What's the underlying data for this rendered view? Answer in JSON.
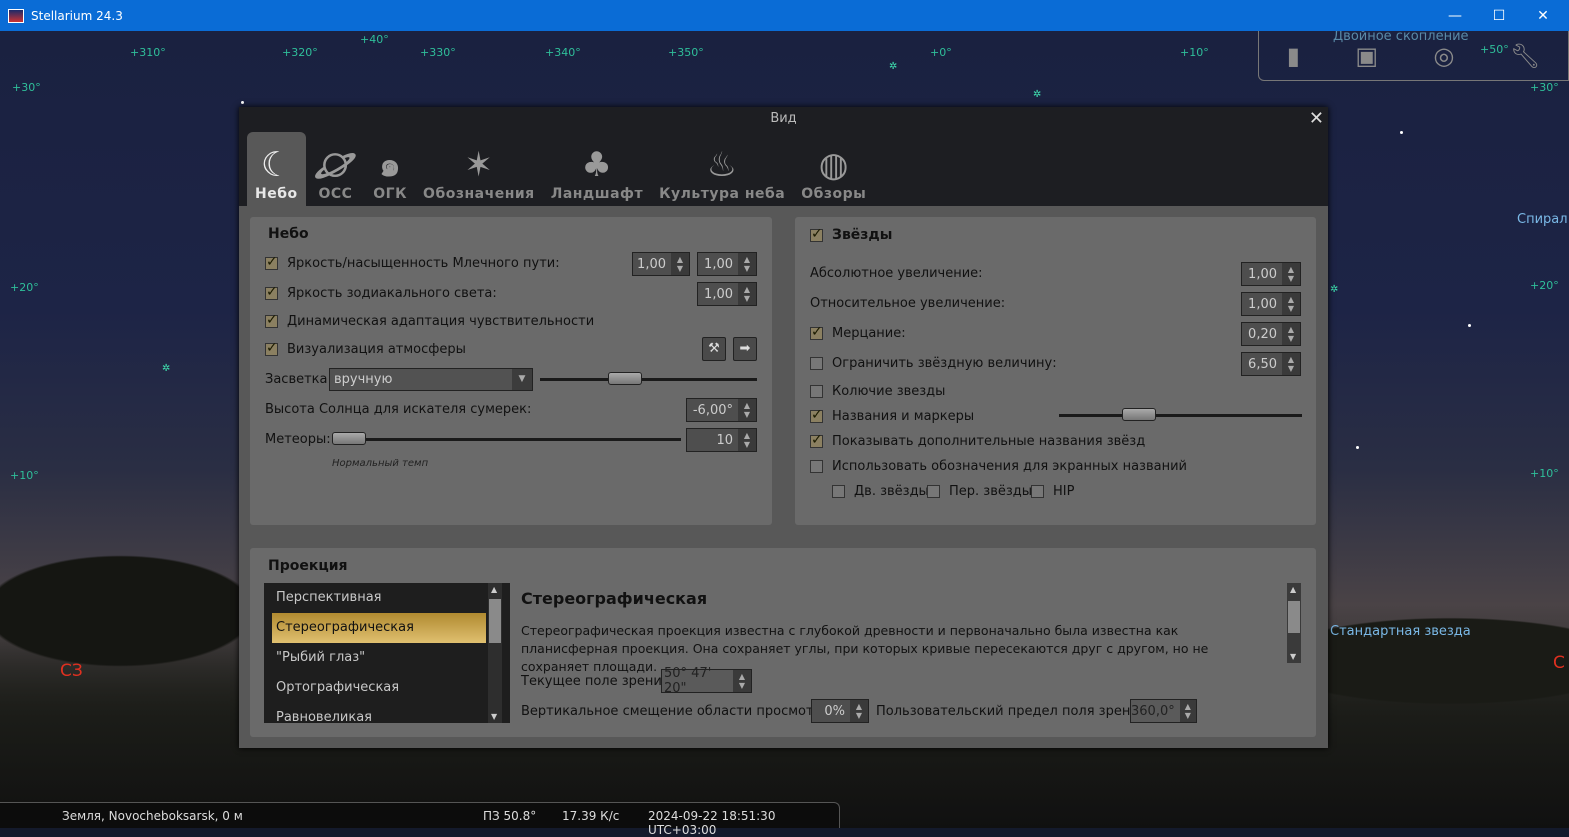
{
  "window": {
    "title": "Stellarium 24.3",
    "minimize": "—",
    "maximize": "☐",
    "close": "✕"
  },
  "sky": {
    "grid_labels": [
      "+310°",
      "+320°",
      "+330°",
      "+340°",
      "+350°",
      "+0°",
      "+10°",
      "+40°",
      "+50°",
      "+30°",
      "+20°",
      "+10°",
      "+30°",
      "+20°",
      "+10°"
    ],
    "cardinal": "СЗ",
    "cardinal_right": "С",
    "objects": [
      "Двойное скопление",
      "Спирал",
      "Стандартная звезда",
      "Стандартная звезда"
    ]
  },
  "top_toolbar": {
    "icons": [
      "telescope-icon",
      "screen-icon",
      "target-icon",
      "wrench-icon"
    ]
  },
  "dialog": {
    "title": "Вид",
    "close": "✕",
    "tabs": [
      {
        "label": "Небо",
        "icon": "sky-icon",
        "active": true
      },
      {
        "label": "ОСС",
        "icon": "solar-system-icon"
      },
      {
        "label": "ОГК",
        "icon": "galaxy-icon"
      },
      {
        "label": "Обозначения",
        "icon": "constellation-icon"
      },
      {
        "label": "Ландшафт",
        "icon": "landscape-icon"
      },
      {
        "label": "Культура неба",
        "icon": "fire-icon"
      },
      {
        "label": "Обзоры",
        "icon": "survey-sphere-icon"
      }
    ],
    "sky": {
      "title": "Небо",
      "milky_way": {
        "label": "Яркость/насыщенность Млечного пути:",
        "checked": true,
        "value1": "1,00",
        "value2": "1,00"
      },
      "zodiacal": {
        "label": "Яркость зодиакального света:",
        "checked": true,
        "value": "1,00"
      },
      "adaptation": {
        "label": "Динамическая адаптация чувствительности",
        "checked": true
      },
      "atmosphere": {
        "label": "Визуализация атмосферы",
        "checked": true
      },
      "light_pollution": {
        "label": "Засветка:",
        "value": "вручную",
        "slider_fraction": 0.4
      },
      "sun_altitude": {
        "label": "Высота Солнца для искателя сумерек:",
        "value": "-6,00°"
      },
      "meteors": {
        "label": "Метеоры:",
        "value": "10",
        "slider_fraction": 0.0,
        "hint": "Нормальный темп"
      }
    },
    "stars": {
      "title": "Звёзды",
      "checked": true,
      "absolute": {
        "label": "Абсолютное увеличение:",
        "value": "1,00"
      },
      "relative": {
        "label": "Относительное увеличение:",
        "value": "1,00"
      },
      "twinkle": {
        "label": "Мерцание:",
        "checked": true,
        "value": "0,20"
      },
      "limit_mag": {
        "label": "Ограничить звёздную величину:",
        "checked": false,
        "value": "6,50"
      },
      "spiky": {
        "label": "Колючие звезды",
        "checked": false
      },
      "labels": {
        "label": "Названия и маркеры",
        "checked": true,
        "slider_fraction": 0.33
      },
      "additional": {
        "label": "Показывать дополнительные названия звёзд",
        "checked": true
      },
      "designations": {
        "label": "Использовать обозначения для экранных названий",
        "checked": false
      },
      "double": {
        "label": "Дв. звёзды",
        "checked": false
      },
      "variable": {
        "label": "Пер. звёзды",
        "checked": false
      },
      "hip": {
        "label": "HIP",
        "checked": false
      }
    },
    "projection": {
      "title": "Проекция",
      "items": [
        "Перспективная",
        "Стереографическая",
        "\"Рыбий глаз\"",
        "Ортографическая",
        "Равновеликая"
      ],
      "selected": "Стереографическая",
      "desc_title": "Стереографическая",
      "desc": "Стереографическая проекция известна с глубокой древности и первоначально была известна как планисферная проекция. Она сохраняет углы, при которых кривые пересекаются друг с другом, но не сохраняет площади.",
      "fov_label": "Текущее поле зрения",
      "fov_value": "50° 47' 20\"",
      "vshift_label": "Вертикальное смещение области просмотра",
      "vshift_value": "0%",
      "fovlimit_label": "Пользовательский предел поля зрения",
      "fovlimit_value": "360,0°"
    }
  },
  "status": {
    "location": "Земля, Novocheboksarsk, 0 м",
    "direction": "ПЗ 50.8°",
    "fps": "17.39 К/с",
    "datetime": "2024-09-22 18:51:30 UTC+03:00"
  }
}
